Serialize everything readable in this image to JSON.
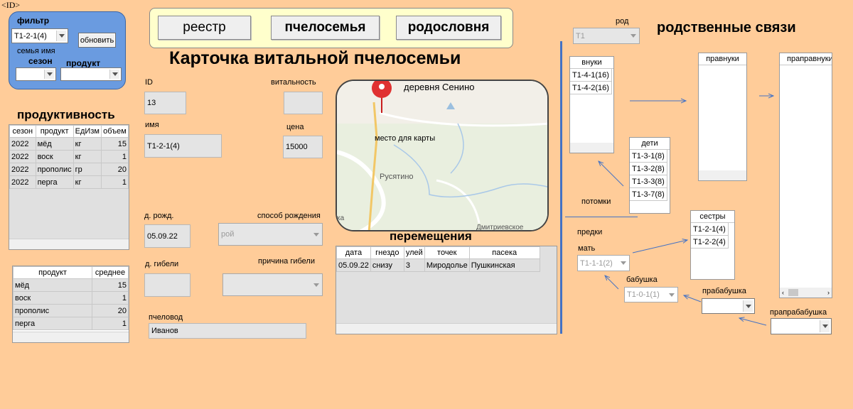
{
  "corner_id": "<ID>",
  "filter": {
    "title": "фильтр",
    "family_combo": "Т1-2-1(4)",
    "refresh_button": "обновить",
    "family_name_label": "семья имя",
    "season_label": "сезон",
    "season_value": "",
    "product_label": "продукт",
    "product_value": ""
  },
  "nav": {
    "registry": "реестр",
    "bee_family": "пчелосемья",
    "pedigree": "родословня"
  },
  "page_title": "Карточка витальной пчелосемьи",
  "productivity": {
    "title": "продуктивность",
    "columns": [
      "сезон",
      "продукт",
      "ЕдИзм",
      "объем"
    ],
    "rows": [
      [
        "2022",
        "мёд",
        "кг",
        "15"
      ],
      [
        "2022",
        "воск",
        "кг",
        "1"
      ],
      [
        "2022",
        "прополис",
        "гр",
        "20"
      ],
      [
        "2022",
        "перга",
        "кг",
        "1"
      ]
    ]
  },
  "averages": {
    "columns": [
      "продукт",
      "среднее"
    ],
    "rows": [
      [
        "мёд",
        "15"
      ],
      [
        "воск",
        "1"
      ],
      [
        "прополис",
        "20"
      ],
      [
        "перга",
        "1"
      ]
    ]
  },
  "card": {
    "id_label": "ID",
    "id_value": "13",
    "vitality_label": "витальность",
    "vitality_value": "",
    "name_label": "имя",
    "name_value": "Т1-2-1(4)",
    "price_label": "цена",
    "price_value": "15000",
    "birth_label": "д. рожд.",
    "birth_value": "05.09.22",
    "birth_method_label": "способ рождения",
    "birth_method_value": "рой",
    "death_label": "д. гибели",
    "death_value": "",
    "death_reason_label": "причина гибели",
    "death_reason_value": "",
    "beekeeper_label": "пчеловод",
    "beekeeper_value": "Иванов"
  },
  "map": {
    "village_label": "деревня Сенино",
    "placeholder_label": "место для карты",
    "town_label": "Русятино",
    "edge_label_left": "ка",
    "edge_label_bottom": "Дмитриевское"
  },
  "moves": {
    "title": "перемещения",
    "columns": [
      "дата",
      "гнездо",
      "улей",
      "точек",
      "пасека"
    ],
    "rows": [
      [
        "05.09.22",
        "снизу",
        "3",
        "Миродолье",
        "Пушкинская"
      ]
    ]
  },
  "relations": {
    "title": "родственные связи",
    "rod_label": "род",
    "rod_value": "Т1",
    "grandchildren_header": "внуки",
    "grandchildren": [
      "Т1-4-1(16)",
      "Т1-4-2(16)"
    ],
    "great_grandchildren_header": "правнуки",
    "great_great_grandchildren_header": "праправнуки",
    "children_header": "дети",
    "children": [
      "Т1-3-1(8)",
      "Т1-3-2(8)",
      "Т1-3-3(8)",
      "Т1-3-7(8)"
    ],
    "descendants_label": "потомки",
    "ancestors_label": "предки",
    "sisters_header": "сестры",
    "sisters": [
      "Т1-2-1(4)",
      "Т1-2-2(4)"
    ],
    "mother_label": "мать",
    "mother_value": "Т1-1-1(2)",
    "grandmother_label": "бабушка",
    "grandmother_value": "Т1-0-1(1)",
    "great_grandmother_label": "прабабушка",
    "great_grandmother_value": "",
    "great_great_grandmother_label": "прапрабабушка",
    "great_great_grandmother_value": ""
  }
}
